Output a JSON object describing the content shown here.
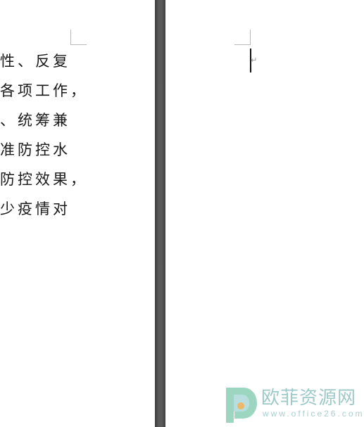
{
  "document": {
    "left_page_lines": [
      "性、反复",
      "各项工作，",
      "、统筹兼",
      "准防控水",
      "防控效果，",
      "少疫情对"
    ],
    "paragraph_mark": "↵"
  },
  "watermark": {
    "name": "欧菲资源网",
    "url": "www.office26.com",
    "colors": {
      "logo_green": "#8ccfb5",
      "logo_teal": "#7ec3c6",
      "logo_orange": "#f3b45a",
      "text": "#9fc9c8"
    }
  },
  "colors": {
    "page_background": "#ffffff",
    "page_gap": "#4b4b4b",
    "text": "#1a1a1a"
  }
}
